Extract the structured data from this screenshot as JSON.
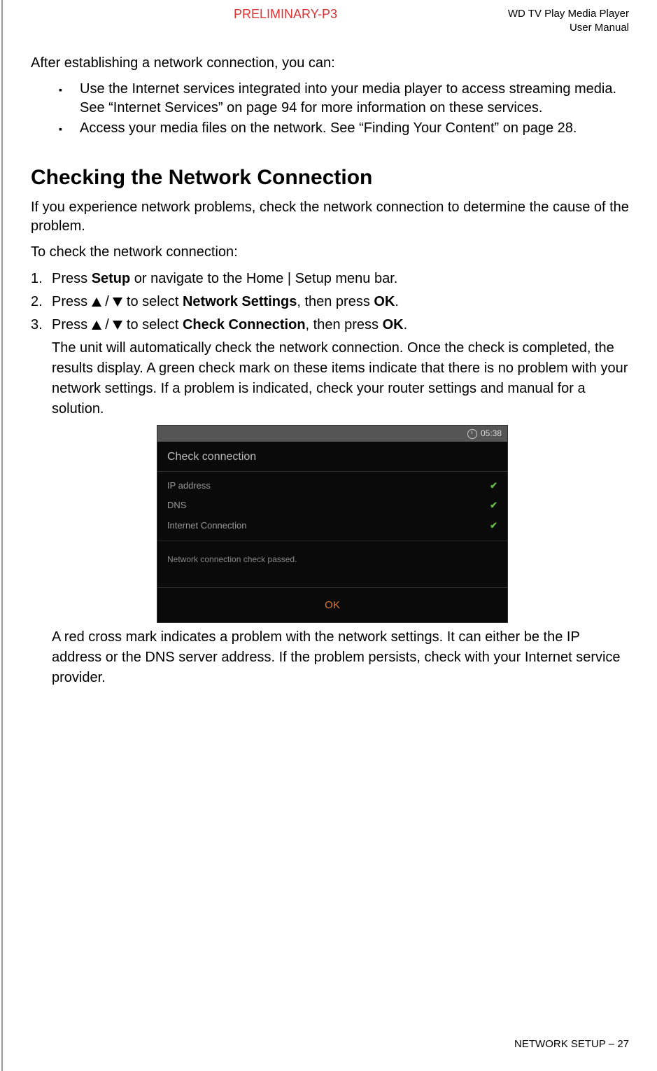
{
  "header": {
    "preliminary": "PRELIMINARY-P3",
    "product": "WD TV Play Media Player",
    "docType": "User Manual"
  },
  "intro": "After establishing a network connection, you can:",
  "bullets": [
    "Use the Internet services integrated into your media player to access streaming media. See “Internet Services” on page 94 for more information on these services.",
    "Access your media files on the network. See “Finding Your Content” on page 28."
  ],
  "heading": "Checking the Network Connection",
  "para1": "If you experience network problems, check the network connection to determine the cause of the problem.",
  "para2": "To check the network connection:",
  "steps": {
    "s1_a": "Press ",
    "s1_b": "Setup",
    "s1_c": " or navigate to the Home | Setup menu bar.",
    "s2_a": "Press ",
    "s2_b": " to select ",
    "s2_c": "Network Settings",
    "s2_d": ", then press ",
    "s2_e": "OK",
    "s2_f": ".",
    "s3_a": "Press ",
    "s3_b": " to select ",
    "s3_c": "Check Connection",
    "s3_d": ", then press ",
    "s3_e": "OK",
    "s3_f": ".",
    "s3_body": "The unit will automatically check the network connection. Once the check is completed, the results display. A green check mark on these items indicate that there is no problem with your network settings. If a problem is indicated, check your router settings and manual for a solution.",
    "s3_after": "A red cross mark indicates a problem with the network settings. It can either be the IP address or the DNS server address. If the problem persists, check with your Internet service provider."
  },
  "screenshot": {
    "time": "05:38",
    "title": "Check connection",
    "rows": [
      {
        "label": "IP address"
      },
      {
        "label": "DNS"
      },
      {
        "label": "Internet Connection"
      }
    ],
    "message": "Network connection check passed.",
    "ok": "OK"
  },
  "footer": {
    "section": "NETWORK SETUP",
    "sep": " – ",
    "page": "27"
  }
}
